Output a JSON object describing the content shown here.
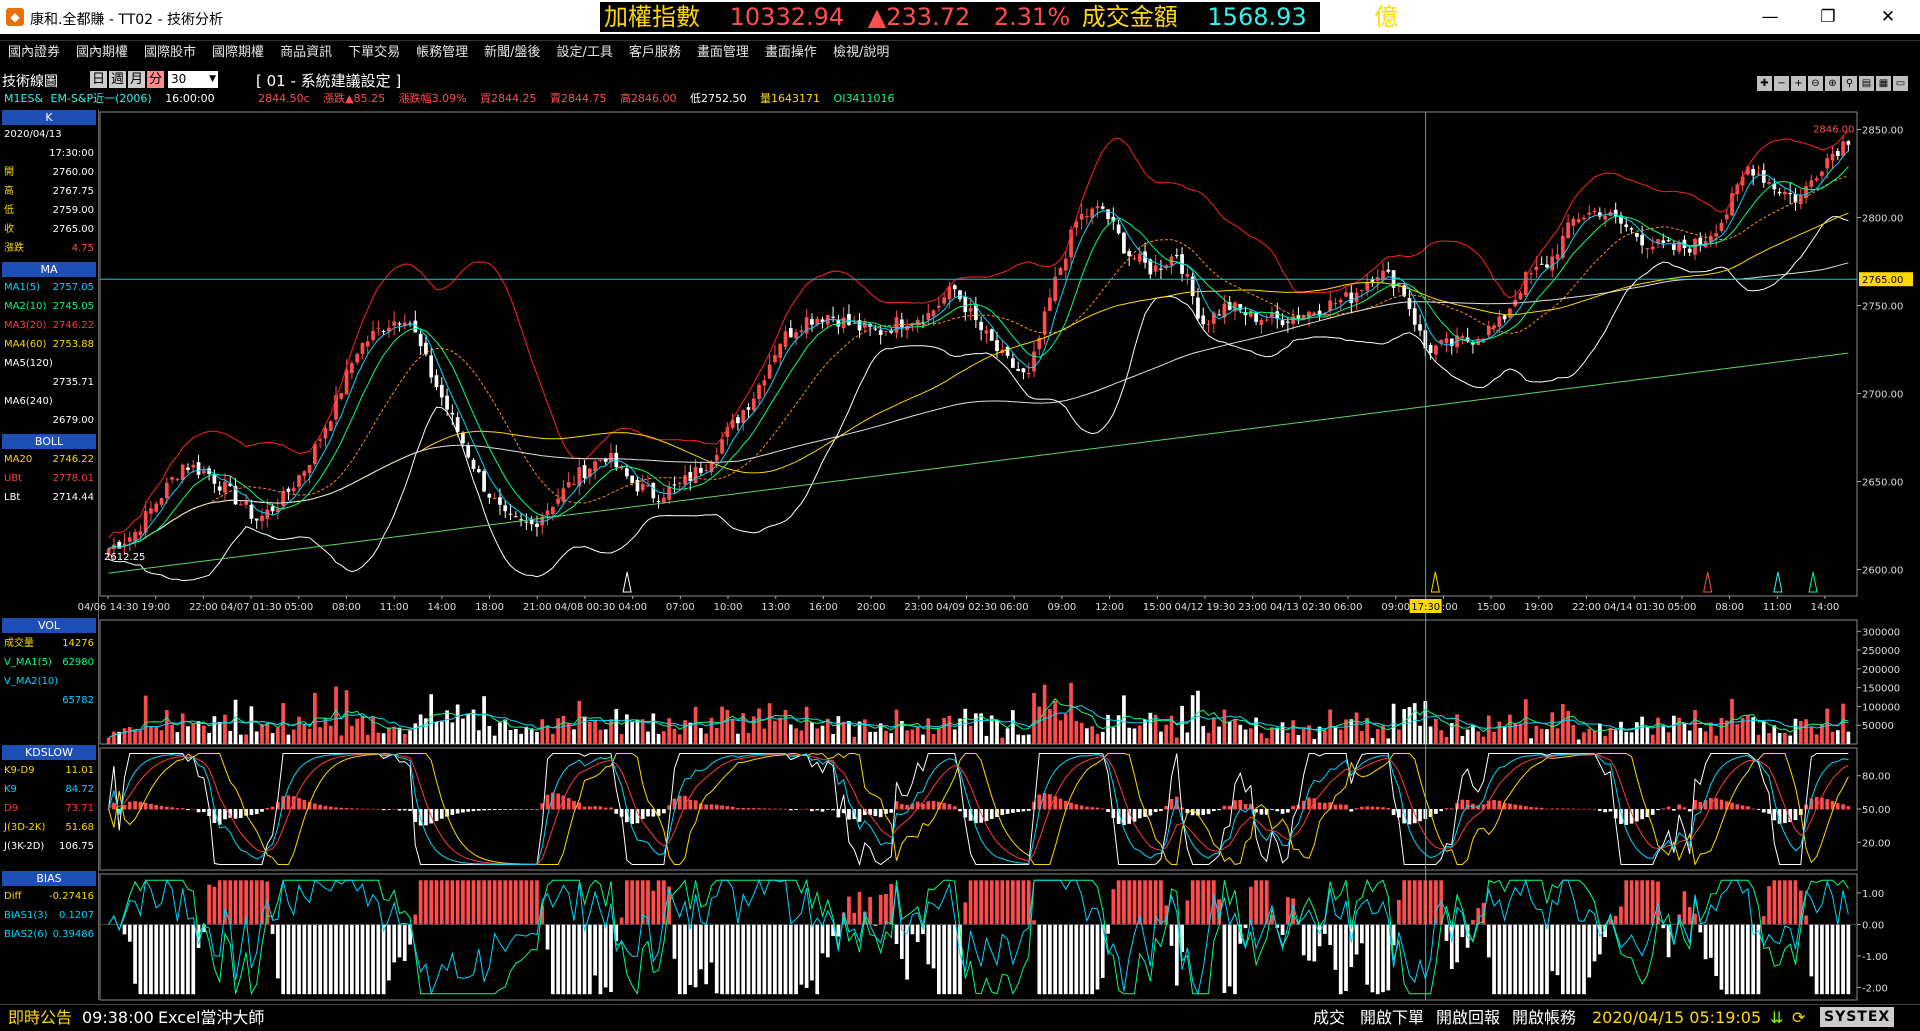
{
  "titlebar": {
    "title": "康和.全都賺 - TT02 - 技術分析",
    "ticker_index_name": "加權指數",
    "ticker_index_value": "10332.94",
    "ticker_change": "▲233.72",
    "ticker_pct": "2.31%",
    "ticker_turnover_label": "成交金額",
    "ticker_turnover_value": "1568.93",
    "ticker_unit": "億",
    "minimize": "—",
    "restore": "❐",
    "close": "✕"
  },
  "menu": [
    "國內證券",
    "國內期權",
    "國際股市",
    "國際期權",
    "商品資訊",
    "下單交易",
    "帳務管理",
    "新聞/盤後",
    "設定/工具",
    "客戶服務",
    "畫面管理",
    "畫面操作",
    "檢視/說明"
  ],
  "toolbar": {
    "label": "技術線圖",
    "periods": [
      "日",
      "週",
      "月",
      "分"
    ],
    "selected_period": "分",
    "count": "30",
    "system_setting": "[ 01 - 系統建議設定 ]"
  },
  "quote": {
    "symbol": "M1ES&",
    "name": "EM-S&P近一(2006)",
    "time": "16:00:00",
    "last": "2844.50c",
    "change": "漲跌▲85.25",
    "change_pct": "漲跌幅3.09%",
    "bid": "買2844.25",
    "ask": "賣2844.75",
    "high": "高2846.00",
    "low": "低2752.50",
    "volume": "量1643171",
    "oi": "OI3411016"
  },
  "sidebar": {
    "k_head": "K",
    "date": "2020/04/13",
    "time": "17:30:00",
    "ohlc": [
      {
        "label": "開",
        "value": "2760.00"
      },
      {
        "label": "高",
        "value": "2767.75"
      },
      {
        "label": "低",
        "value": "2759.00"
      },
      {
        "label": "收",
        "value": "2765.00"
      },
      {
        "label": "漲跌",
        "value": "4.75"
      }
    ],
    "ma_head": "MA",
    "ma": [
      {
        "label": "MA1(5)",
        "value": "2757.05",
        "color": "#00d6ff"
      },
      {
        "label": "MA2(10)",
        "value": "2745.05",
        "color": "#00ff7f"
      },
      {
        "label": "MA3(20)",
        "value": "2746.22",
        "color": "#ff3a3a"
      },
      {
        "label": "MA4(60)",
        "value": "2753.88",
        "color": "#ffd800"
      },
      {
        "label": "MA5(120)",
        "value": "2735.71",
        "color": "#ffffff"
      },
      {
        "label": "MA6(240)",
        "value": "2679.00",
        "color": "#ffffff"
      }
    ],
    "boll_head": "BOLL",
    "boll": [
      {
        "label": "MA20",
        "value": "2746.22",
        "color": "#ffd800"
      },
      {
        "label": "UBt",
        "value": "2778.01",
        "color": "#ff3a3a"
      },
      {
        "label": "LBt",
        "value": "2714.44",
        "color": "#ffffff"
      }
    ],
    "vol_head": "VOL",
    "vol": [
      {
        "label": "成交量",
        "value": "14276",
        "color": "#ffd800"
      },
      {
        "label": "V_MA1(5)",
        "value": "62980",
        "color": "#00ff7f"
      },
      {
        "label": "V_MA2(10)",
        "value": "",
        "color": "#00d6ff"
      },
      {
        "label": "",
        "value": "65782",
        "color": "#00d6ff"
      }
    ],
    "kd_head": "KDSLOW",
    "kd": [
      {
        "label": "K9-D9",
        "value": "11.01",
        "color": "#ffd800"
      },
      {
        "label": "K9",
        "value": "84.72",
        "color": "#00d6ff"
      },
      {
        "label": "D9",
        "value": "73.71",
        "color": "#ff3a3a"
      },
      {
        "label": "J(3D-2K)",
        "value": "51.68",
        "color": "#ffd800"
      },
      {
        "label": "J(3K-2D)",
        "value": "106.75",
        "color": "#ffffff"
      }
    ],
    "bias_head": "BIAS",
    "bias": [
      {
        "label": "Diff",
        "value": "-0.27416",
        "color": "#ffd800"
      },
      {
        "label": "BIAS1(3)",
        "value": "0.1207",
        "color": "#00d6ff"
      },
      {
        "label": "BIAS2(6)",
        "value": "0.39486",
        "color": "#00d6ff"
      }
    ]
  },
  "chart_data": [
    {
      "type": "candlestick",
      "title": "",
      "ylim": [
        2585,
        2860
      ],
      "y_ticks": [
        "2850.00",
        "2800.00",
        "2750.00",
        "2700.00",
        "2650.00",
        "2600.00"
      ],
      "y_tick_values": [
        2850,
        2800,
        2750,
        2700,
        2650,
        2600
      ],
      "x_labels": [
        "04/06 14:30",
        "19:00",
        "22:00",
        "04/07 01:30",
        "05:00",
        "08:00",
        "11:00",
        "14:00",
        "18:00",
        "21:00",
        "04/08 00:30",
        "04:00",
        "07:00",
        "10:00",
        "13:00",
        "16:00",
        "20:00",
        "23:00",
        "04/09 02:30",
        "06:00",
        "09:00",
        "12:00",
        "15:00",
        "04/12 19:30",
        "23:00",
        "04/13 02:30",
        "06:00",
        "09:00",
        "12:00",
        "15:00",
        "19:00",
        "22:00",
        "04/14 01:30",
        "05:00",
        "08:00",
        "11:00",
        "14:00"
      ],
      "cursor_time": "17:30",
      "cursor_price": "2765.00",
      "cursor_price_value": 2765,
      "high_mark": "2846.00",
      "high_mark_value": 2846,
      "low_mark": "2612.25",
      "low_mark_value": 2612.25,
      "close_anchors": [
        2612,
        2620,
        2640,
        2660,
        2655,
        2642,
        2628,
        2640,
        2660,
        2690,
        2725,
        2738,
        2745,
        2710,
        2680,
        2650,
        2628,
        2625,
        2640,
        2655,
        2665,
        2650,
        2642,
        2648,
        2660,
        2680,
        2700,
        2730,
        2742,
        2745,
        2738,
        2735,
        2742,
        2745,
        2760,
        2738,
        2720,
        2708,
        2760,
        2800,
        2805,
        2780,
        2770,
        2780,
        2740,
        2750,
        2744,
        2742,
        2745,
        2750,
        2755,
        2770,
        2762,
        2725,
        2728,
        2732,
        2740,
        2765,
        2775,
        2800,
        2804,
        2795,
        2785,
        2782,
        2785,
        2800,
        2830,
        2818,
        2810,
        2832,
        2845
      ]
    },
    {
      "type": "bar",
      "title": "VOL",
      "y_ticks": [
        "300000",
        "250000",
        "200000",
        "150000",
        "100000",
        "50000"
      ],
      "y_tick_values": [
        300000,
        250000,
        200000,
        150000,
        100000,
        50000
      ],
      "ylim": [
        0,
        330000
      ]
    },
    {
      "type": "line",
      "title": "KDSLOW",
      "y_ticks": [
        "80.00",
        "50.00",
        "20.00"
      ],
      "y_tick_values": [
        80,
        50,
        20
      ],
      "ylim": [
        -5,
        105
      ]
    },
    {
      "type": "bar",
      "title": "BIAS",
      "y_ticks": [
        "1.00",
        "0.00",
        "-1.00",
        "-2.00"
      ],
      "y_tick_values": [
        1,
        0,
        -1,
        -2
      ],
      "ylim": [
        -2.4,
        1.6
      ]
    }
  ],
  "status": {
    "announce": "即時公告",
    "time": "09:38:00",
    "excel": "Excel當沖大師",
    "trade": "成交",
    "open_order": "開啟下單",
    "open_report": "開啟回報",
    "open_account": "開啟帳務",
    "datetime": "2020/04/15 05:19:05",
    "brand": "SYSTEX"
  },
  "colors": {
    "up": "#ff4d4d",
    "down": "#ffffff",
    "cursor": "#00d0d0",
    "accent_ticker_label": "#ffd800",
    "accent_ticker_value": "#ff4d4d",
    "ticker_cyan": "#35f2e8"
  }
}
